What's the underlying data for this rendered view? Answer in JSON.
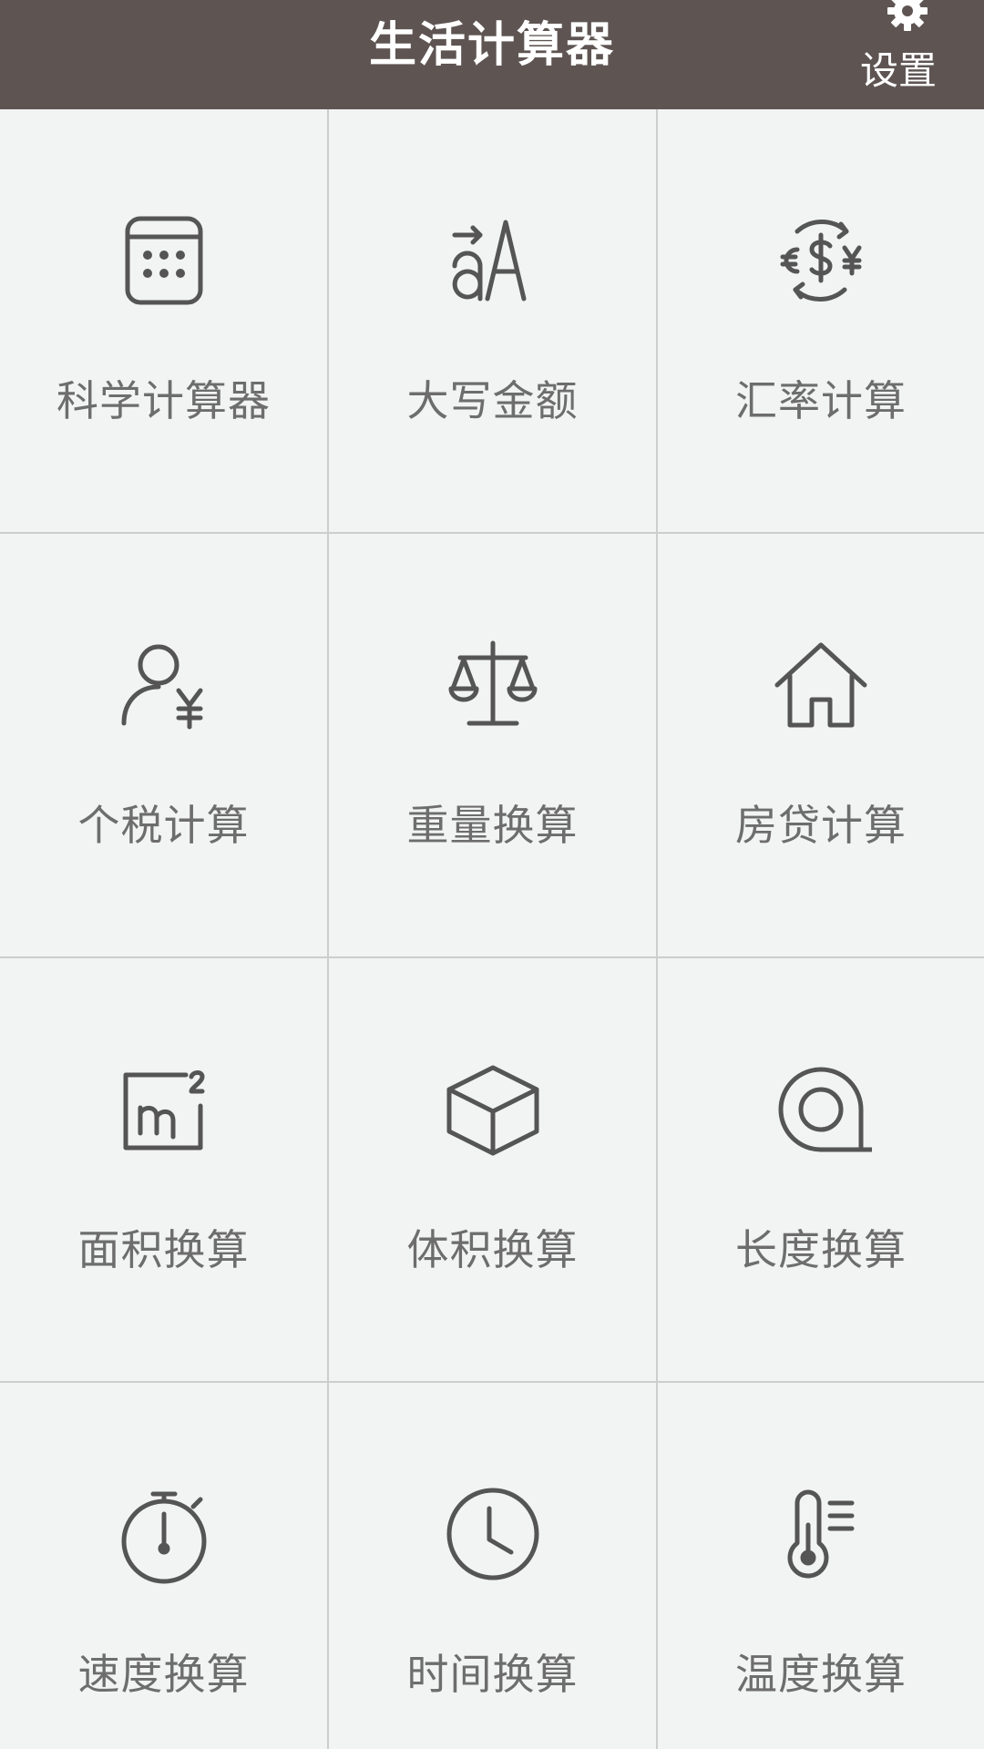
{
  "header": {
    "title": "生活计算器",
    "settings_label": "设置"
  },
  "colors": {
    "header_bg": "#5e5553",
    "page_bg": "#f2f3f3",
    "grid_line": "#cdcdcd",
    "icon_stroke": "#555555",
    "label_text": "#6d6d6d"
  },
  "tiles": [
    {
      "label": "科学计算器",
      "icon": "calculator-icon"
    },
    {
      "label": "大写金额",
      "icon": "text-case-icon"
    },
    {
      "label": "汇率计算",
      "icon": "currency-exchange-icon"
    },
    {
      "label": "个税计算",
      "icon": "person-tax-icon"
    },
    {
      "label": "重量换算",
      "icon": "scale-icon"
    },
    {
      "label": "房贷计算",
      "icon": "house-icon"
    },
    {
      "label": "面积换算",
      "icon": "square-meter-icon"
    },
    {
      "label": "体积换算",
      "icon": "cube-icon"
    },
    {
      "label": "长度换算",
      "icon": "tape-measure-icon"
    },
    {
      "label": "速度换算",
      "icon": "stopwatch-icon"
    },
    {
      "label": "时间换算",
      "icon": "clock-icon"
    },
    {
      "label": "温度换算",
      "icon": "thermometer-icon"
    }
  ]
}
